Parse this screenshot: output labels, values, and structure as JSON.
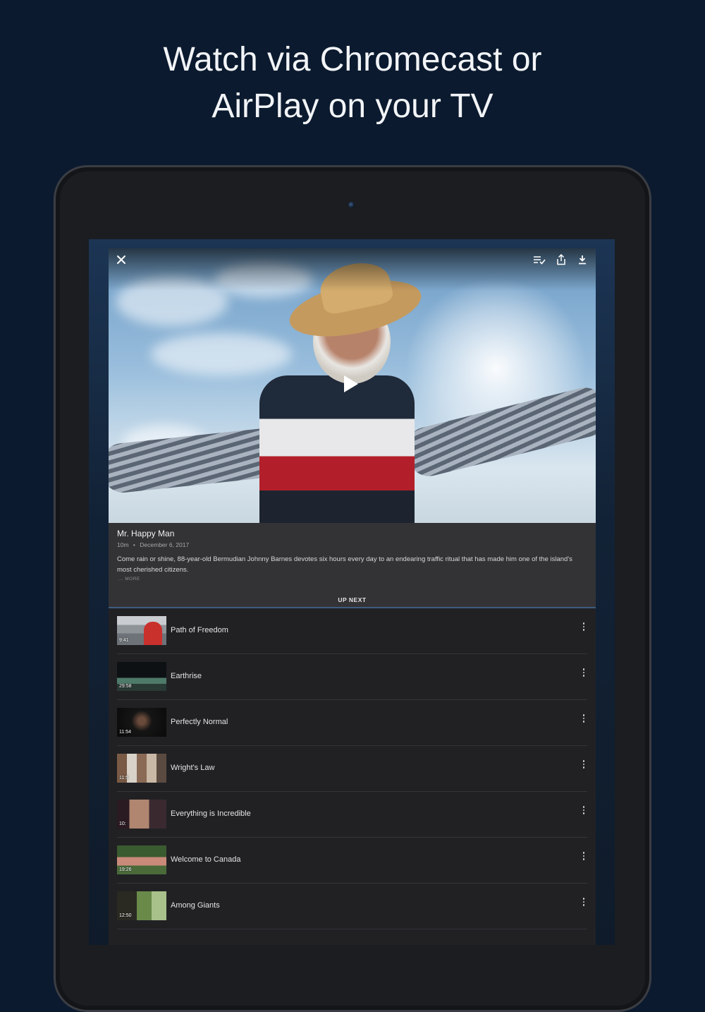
{
  "headline": {
    "line1": "Watch via Chromecast or",
    "line2": "AirPlay on your TV"
  },
  "player": {
    "close_icon": "close-icon",
    "toolbar_icons": [
      "queue-icon",
      "share-icon",
      "download-icon"
    ],
    "play_icon": "play-icon"
  },
  "video_info": {
    "title": "Mr. Happy Man",
    "duration": "10m",
    "separator": "•",
    "date": "December 6, 2017",
    "description": "Come rain or shine, 88-year-old Bermudian Johnny Barnes devotes six hours every day to an endearing traffic ritual that has made him one of the island's most cherished citizens.",
    "more_label": "... MORE",
    "up_next_label": "UP NEXT"
  },
  "up_next": [
    {
      "title": "Path of Freedom",
      "duration": "9:41"
    },
    {
      "title": "Earthrise",
      "duration": "29:58"
    },
    {
      "title": "Perfectly Normal",
      "duration": "11:54"
    },
    {
      "title": "Wright's Law",
      "duration": "11:5"
    },
    {
      "title": "Everything is Incredible",
      "duration": "10:"
    },
    {
      "title": "Welcome to Canada",
      "duration": "19:26"
    },
    {
      "title": "Among Giants",
      "duration": "12:50"
    }
  ],
  "colors": {
    "background": "#0b1a2e",
    "sheet": "#212124",
    "info_panel": "#333336",
    "accent_bar": "#3e5d80"
  }
}
